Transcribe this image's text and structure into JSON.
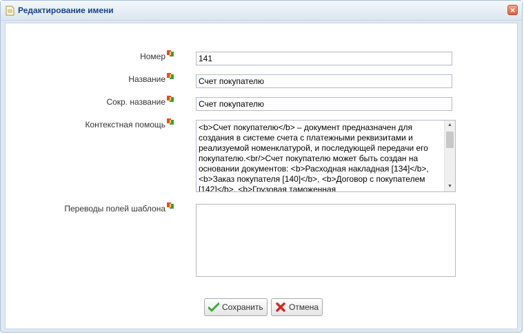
{
  "window": {
    "title": "Редактирование имени",
    "close_glyph": "×"
  },
  "form": {
    "number": {
      "label": "Номер",
      "value": "141"
    },
    "name": {
      "label": "Название",
      "value": "Счет покупателю"
    },
    "short_name": {
      "label": "Сокр. название",
      "value": "Счет покупателю"
    },
    "context_help": {
      "label": "Контекстная помощь",
      "value": "<b>Счет покупателю</b> – документ предназначен для создания в системе счета с платежными реквизитами и реализуемой номенклатурой, и последующей передачи его покупателю.<br/>Счет покупателю может быть создан на основании документов: <b>Расходная накладная [134]</b>, <b>Заказ покупателя [140]</b>, <b>Договор с покупателем [142]</b>, <b>Грузовая таможенная"
    },
    "template_translations": {
      "label": "Переводы полей шаблона",
      "value": ""
    }
  },
  "buttons": {
    "save": "Сохранить",
    "cancel": "Отмена"
  },
  "icons": {
    "title": "document-icon",
    "field_translate": "translate-flag-icon",
    "save": "checkmark-icon",
    "cancel": "red-x-icon"
  }
}
